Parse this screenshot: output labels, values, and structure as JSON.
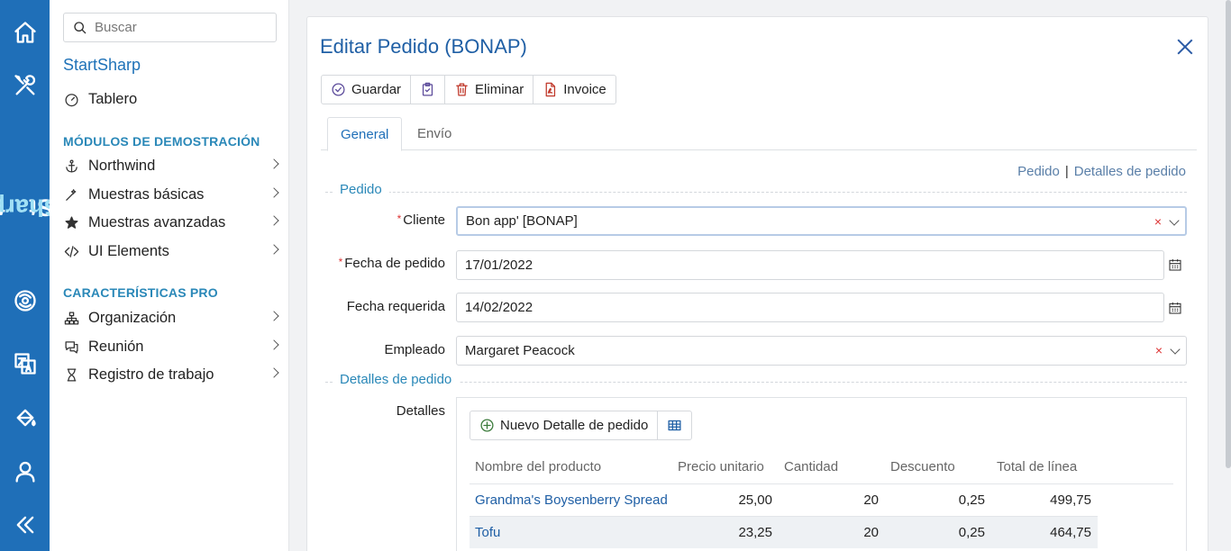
{
  "rail": {
    "brand_part1": "Start",
    "brand_part2": "Sharp",
    "items": [
      "home-icon",
      "tools-icon",
      "logo-icon",
      "translate-icon",
      "paint-bucket-icon",
      "user-icon",
      "collapse-icon"
    ]
  },
  "sidebar": {
    "search_placeholder": "Buscar",
    "app_title": "StartSharp",
    "dashboard": "Tablero",
    "section_demo": "MÓDULOS DE DEMOSTRACIÓN",
    "demo_items": [
      "Northwind",
      "Muestras básicas",
      "Muestras avanzadas",
      "UI Elements"
    ],
    "section_pro": "CARACTERÍSTICAS PRO",
    "pro_items": [
      "Organización",
      "Reunión",
      "Registro de trabajo"
    ]
  },
  "dialog": {
    "title": "Editar Pedido (BONAP)",
    "toolbar": {
      "save": "Guardar",
      "delete": "Eliminar",
      "invoice": "Invoice"
    },
    "tabs": [
      "General",
      "Envío"
    ],
    "links": {
      "order": "Pedido",
      "sep": "|",
      "details": "Detalles de pedido"
    },
    "fieldset_order": "Pedido",
    "fieldset_details": "Detalles de pedido",
    "fields": {
      "customer_label": "Cliente",
      "customer_value": "Bon app' [BONAP]",
      "order_date_label": "Fecha de pedido",
      "order_date_value": "17/01/2022",
      "required_date_label": "Fecha requerida",
      "required_date_value": "14/02/2022",
      "employee_label": "Empleado",
      "employee_value": "Margaret Peacock",
      "details_label": "Detalles",
      "required_mark": "*",
      "clear_mark": "×"
    },
    "grid": {
      "new_button": "Nuevo Detalle de pedido",
      "columns": [
        "Nombre del producto",
        "Precio unitario",
        "Cantidad",
        "Descuento",
        "Total de línea"
      ],
      "rows": [
        {
          "product": "Grandma's Boysenberry Spread",
          "price": "25,00",
          "qty": "20",
          "discount": "0,25",
          "total": "499,75"
        },
        {
          "product": "Tofu",
          "price": "23,25",
          "qty": "20",
          "discount": "0,25",
          "total": "464,75"
        }
      ]
    }
  }
}
